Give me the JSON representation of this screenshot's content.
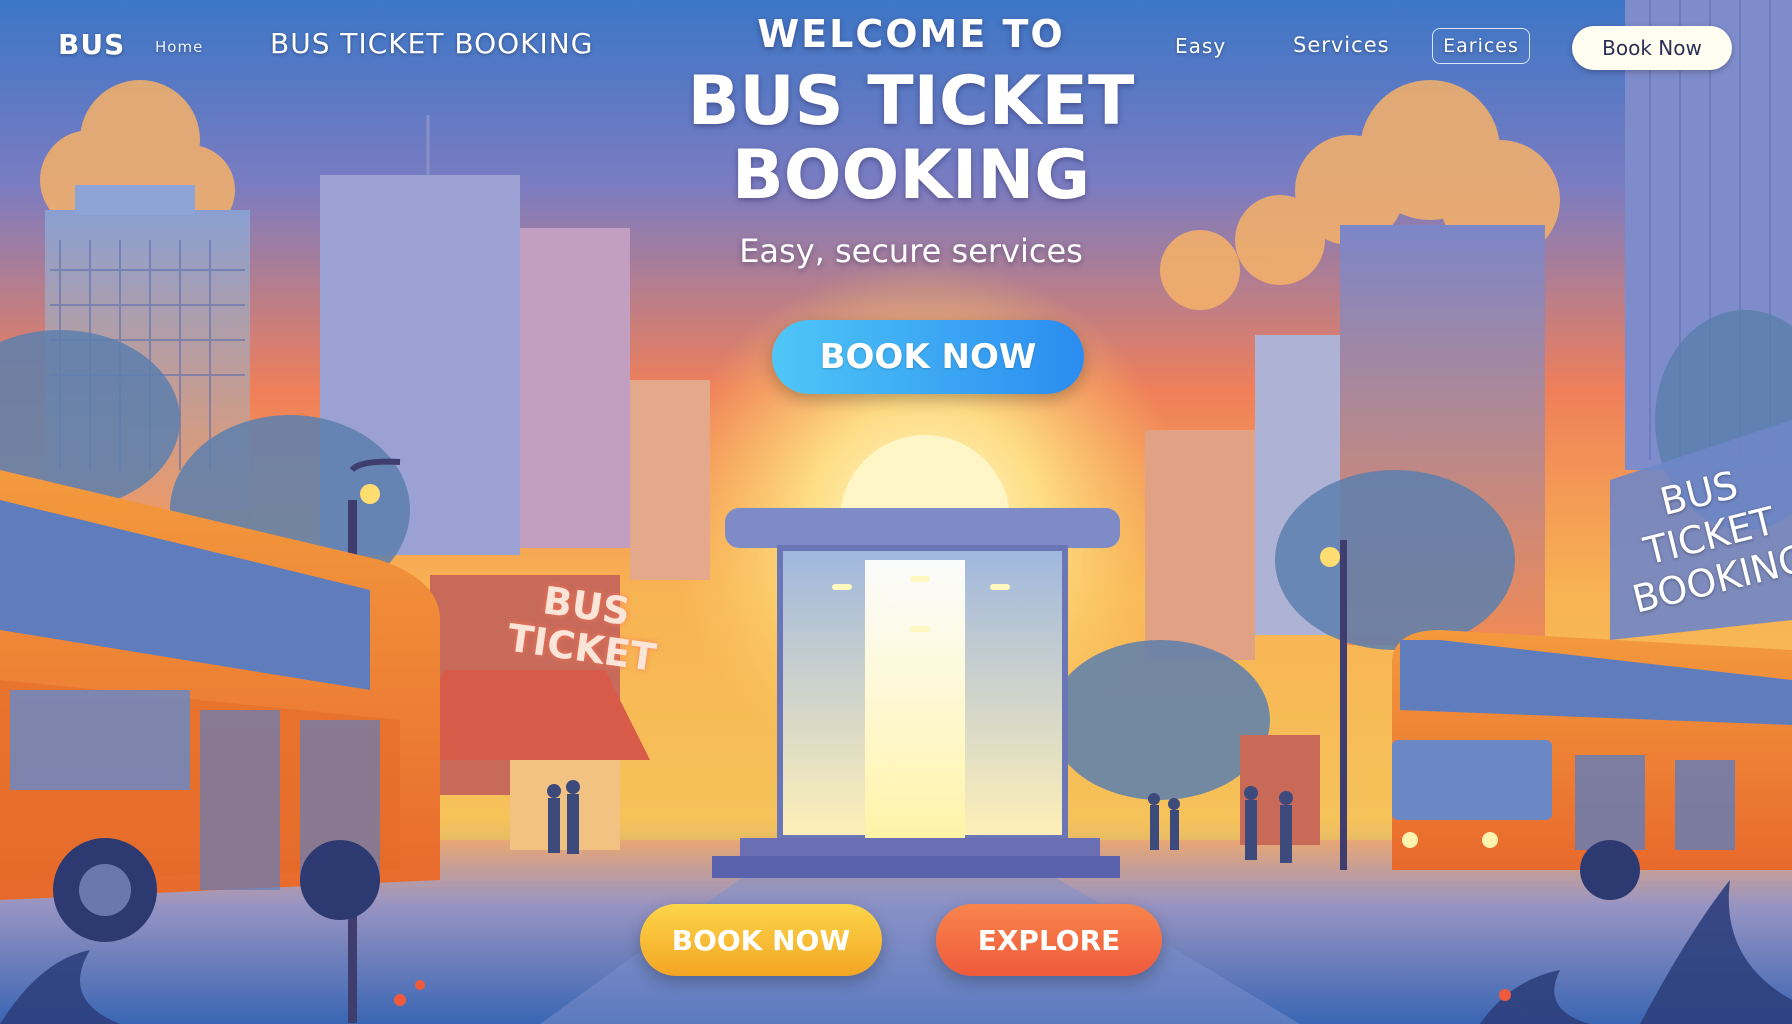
{
  "header": {
    "logo": "BUS",
    "home_link": "Home",
    "brand": "BUS TICKET BOOKING",
    "nav": [
      {
        "label": "Easy"
      },
      {
        "label": "Services"
      },
      {
        "label": "Earices"
      }
    ],
    "book_now_label": "Book Now"
  },
  "hero": {
    "welcome": "WELCOME TO",
    "title_line1": "BUS TICKET",
    "title_line2": "BOOKING",
    "subtitle": "Easy, secure services",
    "cta_label": "BOOK NOW"
  },
  "scene": {
    "left_sign_line1": "BUS",
    "left_sign_line2": "TICKET",
    "right_sign_line1": "BUS",
    "right_sign_line2": "TICKET",
    "right_sign_line3": "BOOKING"
  },
  "footer_buttons": {
    "book_now_label": "BOOK NOW",
    "explore_label": "EXPLORE"
  },
  "colors": {
    "sky_top": "#3f78c4",
    "sky_mid": "#f0855a",
    "sun": "#ffe98a",
    "bus": "#f07a2e",
    "cta_blue": "#2a9bf3",
    "cta_yellow": "#f6b62e",
    "cta_orange": "#f2653f"
  }
}
